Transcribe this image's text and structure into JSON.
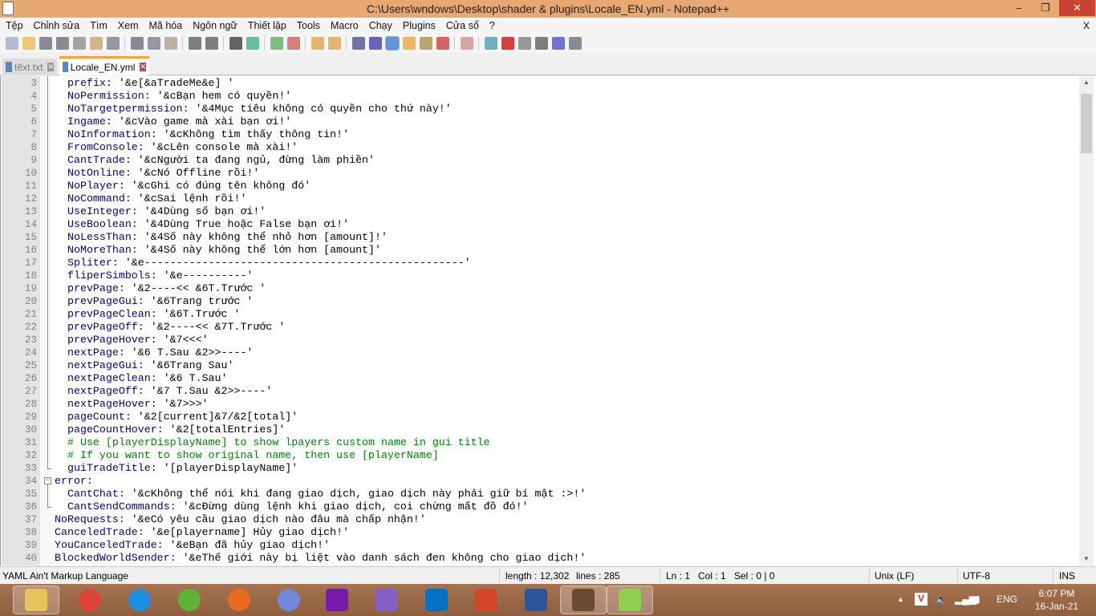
{
  "window": {
    "title": "C:\\Users\\wndows\\Desktop\\shader & plugins\\Locale_EN.yml - Notepad++",
    "minimize": "–",
    "maximize": "❐",
    "close": "✕"
  },
  "menu": [
    "Tệp",
    "Chỉnh sửa",
    "Tìm",
    "Xem",
    "Mã hóa",
    "Ngôn ngữ",
    "Thiết lập",
    "Tools",
    "Macro",
    "Chạy",
    "Plugins",
    "Cửa sổ",
    "?"
  ],
  "menu_close": "X",
  "toolbar_icons": [
    "new-file",
    "open-file",
    "save",
    "save-all",
    "close",
    "close-all",
    "print",
    "cut",
    "copy",
    "paste",
    "undo",
    "redo",
    "find",
    "replace",
    "zoom-in",
    "zoom-out",
    "sync-vertical",
    "sync-horizontal",
    "word-wrap",
    "show-all-chars",
    "indent-guide",
    "udl",
    "doc-map",
    "function-list",
    "folder-workspace",
    "monitor",
    "record-macro",
    "stop-record",
    "play-macro",
    "run-multiple",
    "save-macro"
  ],
  "tabs": [
    {
      "label": "tẽxt.txt",
      "active": false
    },
    {
      "label": "Locale_EN.yml",
      "active": true
    }
  ],
  "editor": {
    "lines": [
      {
        "n": "3",
        "lvl": 1,
        "key": "prefix:",
        "val": " '&e[&aTradeMe&e] '"
      },
      {
        "n": "4",
        "lvl": 1,
        "key": "NoPermission:",
        "val": " '&cBạn hem có quyền!'"
      },
      {
        "n": "5",
        "lvl": 1,
        "key": "NoTargetpermission:",
        "val": " '&4Mục tiêu không có quyền cho thứ này!'"
      },
      {
        "n": "6",
        "lvl": 1,
        "key": "Ingame:",
        "val": " '&cVào game mà xài bạn ơi!'"
      },
      {
        "n": "7",
        "lvl": 1,
        "key": "NoInformation:",
        "val": " '&cKhông tìm thấy thông tin!'"
      },
      {
        "n": "8",
        "lvl": 1,
        "key": "FromConsole:",
        "val": " '&cLên console mà xài!'"
      },
      {
        "n": "9",
        "lvl": 1,
        "key": "CantTrade:",
        "val": " '&cNgười ta đang ngủ, đừng làm phiền'"
      },
      {
        "n": "10",
        "lvl": 1,
        "key": "NotOnline:",
        "val": " '&cNó Offline rồi!'"
      },
      {
        "n": "11",
        "lvl": 1,
        "key": "NoPlayer:",
        "val": " '&cGhi có đúng tên không đó'"
      },
      {
        "n": "12",
        "lvl": 1,
        "key": "NoCommand:",
        "val": " '&cSai lệnh rồi!'"
      },
      {
        "n": "13",
        "lvl": 1,
        "key": "UseInteger:",
        "val": " '&4Dùng số bạn ơi!'"
      },
      {
        "n": "14",
        "lvl": 1,
        "key": "UseBoolean:",
        "val": " '&4Dùng True hoặc False bạn ơi!'"
      },
      {
        "n": "15",
        "lvl": 1,
        "key": "NoLessThan:",
        "val": " '&4Số này không thể nhỏ hơn [amount]!'"
      },
      {
        "n": "16",
        "lvl": 1,
        "key": "NoMoreThan:",
        "val": " '&4Số này không thể lớn hơn [amount]'"
      },
      {
        "n": "17",
        "lvl": 1,
        "key": "Spliter:",
        "val": " '&e--------------------------------------------------'"
      },
      {
        "n": "18",
        "lvl": 1,
        "key": "fliperSimbols:",
        "val": " '&e----------'"
      },
      {
        "n": "19",
        "lvl": 1,
        "key": "prevPage:",
        "val": " '&2----<< &6T.Trước '"
      },
      {
        "n": "20",
        "lvl": 1,
        "key": "prevPageGui:",
        "val": " '&6Trang trước '"
      },
      {
        "n": "21",
        "lvl": 1,
        "key": "prevPageClean:",
        "val": " '&6T.Trước '"
      },
      {
        "n": "22",
        "lvl": 1,
        "key": "prevPageOff:",
        "val": " '&2----<< &7T.Trước '"
      },
      {
        "n": "23",
        "lvl": 1,
        "key": "prevPageHover:",
        "val": " '&7<<<'"
      },
      {
        "n": "24",
        "lvl": 1,
        "key": "nextPage:",
        "val": " '&6 T.Sau &2>>----'"
      },
      {
        "n": "25",
        "lvl": 1,
        "key": "nextPageGui:",
        "val": " '&6Trang Sau'"
      },
      {
        "n": "26",
        "lvl": 1,
        "key": "nextPageClean:",
        "val": " '&6 T.Sau'"
      },
      {
        "n": "27",
        "lvl": 1,
        "key": "nextPageOff:",
        "val": " '&7 T.Sau &2>>----'"
      },
      {
        "n": "28",
        "lvl": 1,
        "key": "nextPageHover:",
        "val": " '&7>>>'"
      },
      {
        "n": "29",
        "lvl": 1,
        "key": "pageCount:",
        "val": " '&2[current]&7/&2[total]'"
      },
      {
        "n": "30",
        "lvl": 1,
        "key": "pageCountHover:",
        "val": " '&2[totalEntries]'"
      },
      {
        "n": "31",
        "lvl": 1,
        "cmt": "# Use [playerDisplayName] to show lpayers custom name in gui title"
      },
      {
        "n": "32",
        "lvl": 1,
        "cmt": "# If you want to show original name, then use [playerName]"
      },
      {
        "n": "33",
        "lvl": 1,
        "key": "guiTradeTitle:",
        "val": " '[playerDisplayName]'",
        "foldend": true
      },
      {
        "n": "34",
        "lvl": 0,
        "key": "error:",
        "val": "",
        "fold": "−"
      },
      {
        "n": "35",
        "lvl": 1,
        "key": "CantChat:",
        "val": " '&cKhông thể nói khi đang giao dịch, giao dịch này phải giữ bí mật :>!'"
      },
      {
        "n": "36",
        "lvl": 1,
        "key": "CantSendCommands:",
        "val": " '&cĐừng dùng lệnh khi giao dịch, coi chừng mất đồ đó!'",
        "foldend": true
      },
      {
        "n": "37",
        "lvl": 0,
        "key": "NoRequests:",
        "val": " '&eCó yêu cầu giao dịch nào đâu mà chấp nhận!'"
      },
      {
        "n": "38",
        "lvl": 0,
        "key": "CanceledTrade:",
        "val": " '&e[playername] Hủy giao dịch!'"
      },
      {
        "n": "39",
        "lvl": 0,
        "key": "YouCanceledTrade:",
        "val": " '&eBạn đã hủy giao dịch!'"
      },
      {
        "n": "40",
        "lvl": 0,
        "key": "BlockedWorldSender:",
        "val": " '&eThế giới này bị liệt vào danh sách đen không cho giao dịch!'"
      }
    ]
  },
  "scrollbar": {
    "position_fraction": 0.0
  },
  "status": {
    "language": "YAML Ain't Markup Language",
    "length": "length : 12,302",
    "lines": "lines : 285",
    "ln": "Ln : 1",
    "col": "Col : 1",
    "sel": "Sel : 0 | 0",
    "eol": "Unix (LF)",
    "encoding": "UTF-8",
    "mode": "INS"
  },
  "taskbar": {
    "apps": [
      {
        "name": "file-explorer",
        "color": "#e8c25a"
      },
      {
        "name": "chrome",
        "color": "#db4437"
      },
      {
        "name": "internet-explorer",
        "color": "#1f8fe0"
      },
      {
        "name": "coc-coc",
        "color": "#5fb336"
      },
      {
        "name": "firefox",
        "color": "#e66b1f"
      },
      {
        "name": "discord",
        "color": "#7289da"
      },
      {
        "name": "onenote",
        "color": "#7719aa"
      },
      {
        "name": "visual-studio",
        "color": "#865fc5"
      },
      {
        "name": "outlook",
        "color": "#0072c6"
      },
      {
        "name": "powerpoint",
        "color": "#d24726"
      },
      {
        "name": "word",
        "color": "#2b579a"
      },
      {
        "name": "minecraft",
        "color": "#6b4a2e"
      },
      {
        "name": "notepad-plus-plus",
        "color": "#8fd14f"
      }
    ],
    "tray": {
      "show_hidden": "▲",
      "lang": "ENG",
      "time": "6:07 PM",
      "date": "16-Jan-21"
    }
  }
}
